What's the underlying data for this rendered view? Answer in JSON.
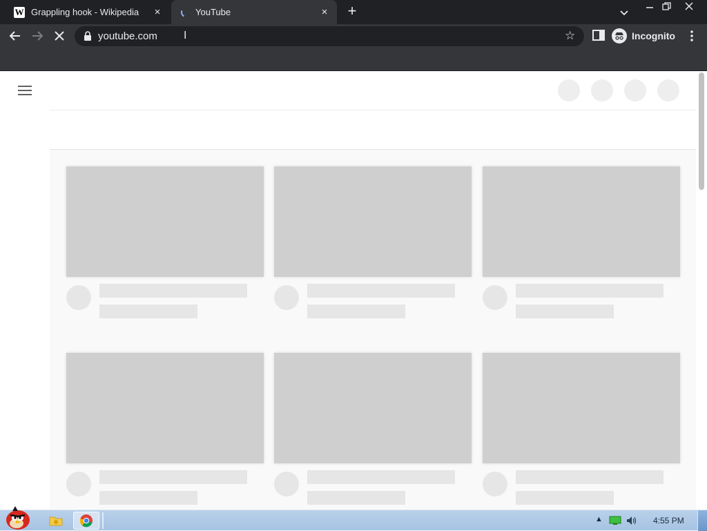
{
  "browser": {
    "tabs": [
      {
        "title": "Grappling hook - Wikipedia",
        "favicon": "W",
        "active": false
      },
      {
        "title": "YouTube",
        "favicon": "loading-spinner",
        "active": true
      }
    ],
    "new_tab_icon": "+",
    "close_icon": "×",
    "url": "youtube.com",
    "profile_label": "Incognito"
  },
  "page": {
    "site": "YouTube",
    "state": "loading-skeleton"
  },
  "taskbar": {
    "time": "4:55 PM"
  },
  "colors": {
    "tabbar": "#202124",
    "toolbar": "#35363a",
    "skeleton_thumb": "#cfcfcf",
    "skeleton_text": "#e6e6e6",
    "taskbar": "#b9d1ea"
  }
}
